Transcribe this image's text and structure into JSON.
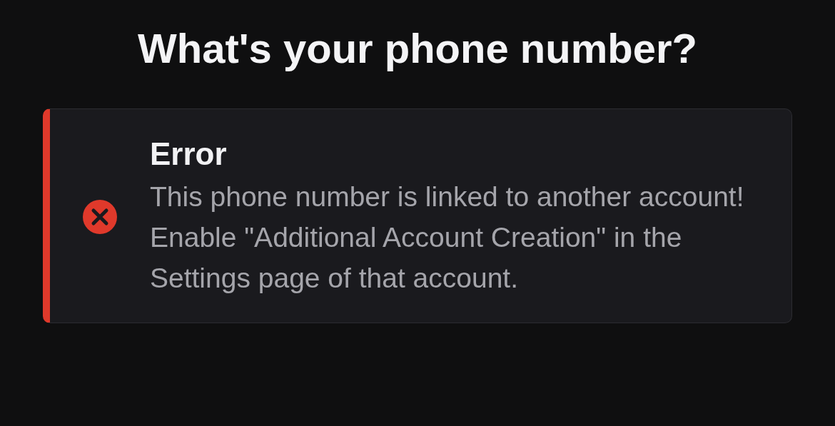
{
  "heading": "What's your phone number?",
  "alert": {
    "kind": "error",
    "title": "Error",
    "message": "This phone number is linked to another account! Enable \"Additional Account Creation\" in the Settings page of that account."
  }
}
